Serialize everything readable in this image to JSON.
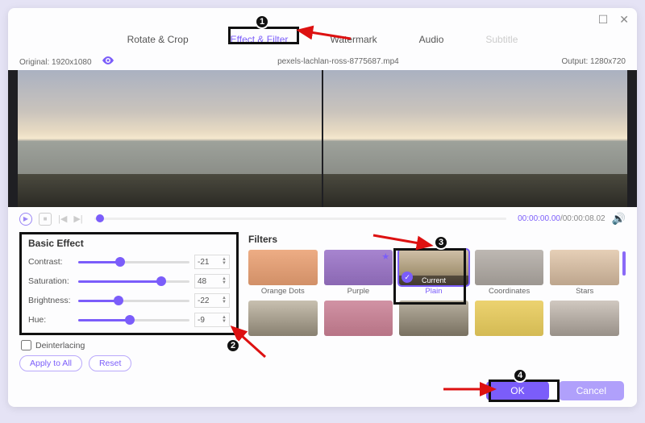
{
  "window": {
    "maximize": "☐",
    "close": "✕"
  },
  "tabs": {
    "rotate": "Rotate & Crop",
    "effect": "Effect & Filter",
    "watermark": "Watermark",
    "audio": "Audio",
    "subtitle": "Subtitle"
  },
  "infobar": {
    "original_label": "Original:",
    "original_res": "1920x1080",
    "filename": "pexels-lachlan-ross-8775687.mp4",
    "output_label": "Output:",
    "output_res": "1280x720"
  },
  "playback": {
    "current": "00:00:00.00",
    "sep": "/",
    "duration": "00:00:08.02"
  },
  "basic": {
    "title": "Basic Effect",
    "contrast_label": "Contrast:",
    "contrast_val": "-21",
    "saturation_label": "Saturation:",
    "saturation_val": "48",
    "brightness_label": "Brightness:",
    "brightness_val": "-22",
    "hue_label": "Hue:",
    "hue_val": "-9",
    "deinterlacing": "Deinterlacing",
    "apply_all": "Apply to All",
    "reset": "Reset"
  },
  "filters": {
    "title": "Filters",
    "items": [
      {
        "label": "Orange Dots"
      },
      {
        "label": "Purple"
      },
      {
        "label": "Plain",
        "selected": true,
        "current": "Current"
      },
      {
        "label": "Coordinates"
      },
      {
        "label": "Stars"
      },
      {
        "label": ""
      },
      {
        "label": ""
      },
      {
        "label": ""
      },
      {
        "label": ""
      },
      {
        "label": ""
      }
    ]
  },
  "footer": {
    "ok": "OK",
    "cancel": "Cancel"
  },
  "badges": {
    "b1": "1",
    "b2": "2",
    "b3": "3",
    "b4": "4"
  }
}
